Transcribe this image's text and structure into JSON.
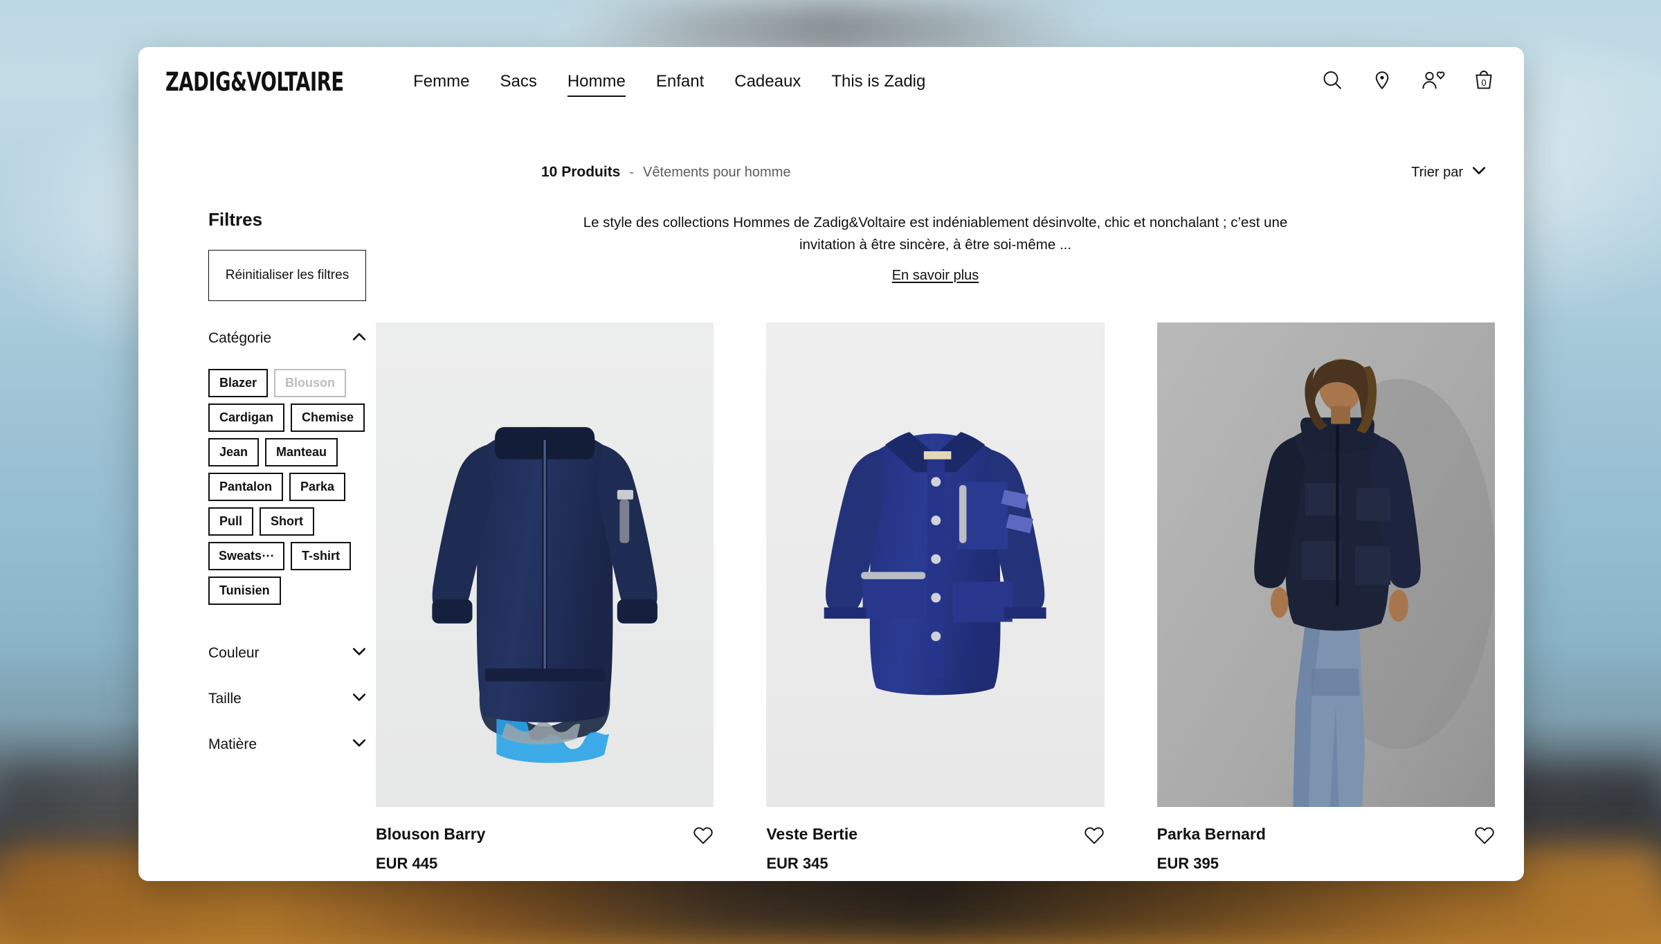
{
  "site": {
    "logo": "ZADIG&VOLTAIRE"
  },
  "nav": {
    "items": [
      {
        "label": "Femme",
        "active": false
      },
      {
        "label": "Sacs",
        "active": false
      },
      {
        "label": "Homme",
        "active": true
      },
      {
        "label": "Enfant",
        "active": false
      },
      {
        "label": "Cadeaux",
        "active": false
      },
      {
        "label": "This is Zadig",
        "active": false
      }
    ]
  },
  "header_icons": {
    "search": "search-icon",
    "store": "location-pin-icon",
    "account": "account-heart-icon",
    "bag": "shopping-bag-icon",
    "bag_count": "0"
  },
  "sub_header": {
    "product_count": "10 Produits",
    "separator": "-",
    "category": "Vêtements pour homme",
    "sort_label": "Trier par",
    "sort_icon": "chevron-down-icon"
  },
  "sidebar": {
    "title": "Filtres",
    "reset_label": "Réinitialiser les filtres",
    "sections": [
      {
        "label": "Catégorie",
        "expanded": true,
        "icon": "chevron-up-icon"
      },
      {
        "label": "Couleur",
        "expanded": false,
        "icon": "chevron-down-icon"
      },
      {
        "label": "Taille",
        "expanded": false,
        "icon": "chevron-down-icon"
      },
      {
        "label": "Matière",
        "expanded": false,
        "icon": "chevron-down-icon"
      }
    ],
    "categories": [
      {
        "label": "Blazer",
        "disabled": false
      },
      {
        "label": "Blouson",
        "disabled": true
      },
      {
        "label": "Cardigan",
        "disabled": false
      },
      {
        "label": "Chemise",
        "disabled": false
      },
      {
        "label": "Jean",
        "disabled": false
      },
      {
        "label": "Manteau",
        "disabled": false
      },
      {
        "label": "Pantalon",
        "disabled": false
      },
      {
        "label": "Parka",
        "disabled": false
      },
      {
        "label": "Pull",
        "disabled": false
      },
      {
        "label": "Short",
        "disabled": false
      },
      {
        "label": "Sweats⋯",
        "disabled": false
      },
      {
        "label": "T-shirt",
        "disabled": false
      },
      {
        "label": "Tunisien",
        "disabled": false
      }
    ]
  },
  "intro": {
    "text": "Le style des collections Hommes de Zadig&Voltaire est indéniablement désinvolte, chic et nonchalant ; c’est une invitation à être sincère, à être soi-même ...",
    "link": "En savoir plus"
  },
  "products": [
    {
      "name": "Blouson Barry",
      "price": "EUR 445",
      "wishlist_icon": "heart-outline-icon",
      "art": "navy-bomber-jacket"
    },
    {
      "name": "Veste Bertie",
      "price": "EUR 345",
      "wishlist_icon": "heart-outline-icon",
      "art": "blue-work-jacket"
    },
    {
      "name": "Parka Bernard",
      "price": "EUR 395",
      "wishlist_icon": "heart-outline-icon",
      "art": "model-navy-parka"
    }
  ]
}
